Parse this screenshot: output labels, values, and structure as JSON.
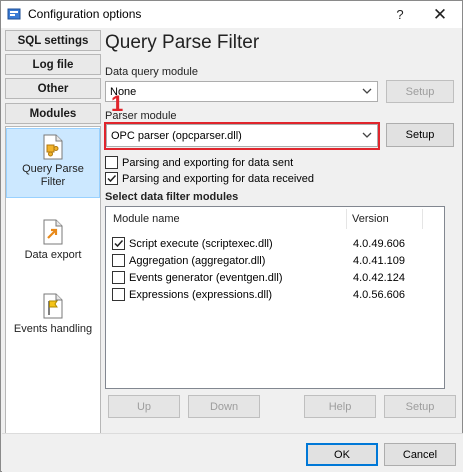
{
  "window": {
    "title": "Configuration options",
    "help_glyph": "?",
    "close_glyph": "✕"
  },
  "nav_tabs": [
    {
      "label": "SQL settings"
    },
    {
      "label": "Log file"
    },
    {
      "label": "Other"
    },
    {
      "label": "Modules"
    }
  ],
  "modules": [
    {
      "label_line1": "Query Parse",
      "label_line2": "Filter",
      "icon": "puzzle-icon",
      "selected": true
    },
    {
      "label_line1": "Data export",
      "label_line2": "",
      "icon": "export-icon",
      "selected": false
    },
    {
      "label_line1": "Events handling",
      "label_line2": "",
      "icon": "flag-icon",
      "selected": false
    }
  ],
  "page": {
    "title": "Query Parse Filter",
    "data_query_label": "Data query module",
    "data_query_value": "None",
    "setup_label": "Setup",
    "parser_label": "Parser module",
    "parser_value": "OPC parser (opcparser.dll)",
    "marker": "1",
    "chk_sent": {
      "label": "Parsing and exporting for data sent",
      "checked": false
    },
    "chk_received": {
      "label": "Parsing and exporting for data received",
      "checked": true
    },
    "filter_title": "Select data filter modules",
    "col_name": "Module name",
    "col_version": "Version",
    "rows": [
      {
        "name": "Script execute (scriptexec.dll)",
        "version": "4.0.49.606",
        "checked": true
      },
      {
        "name": "Aggregation (aggregator.dll)",
        "version": "4.0.41.109",
        "checked": false
      },
      {
        "name": "Events generator (eventgen.dll)",
        "version": "4.0.42.124",
        "checked": false
      },
      {
        "name": "Expressions (expressions.dll)",
        "version": "4.0.56.606",
        "checked": false
      }
    ],
    "btn_up": "Up",
    "btn_down": "Down",
    "btn_help": "Help",
    "btn_setup": "Setup"
  },
  "footer": {
    "ok_label": "OK",
    "cancel_label": "Cancel"
  },
  "colors": {
    "accent": "#0078d7",
    "highlight_red": "#e0252c",
    "selection": "#cce8ff"
  }
}
